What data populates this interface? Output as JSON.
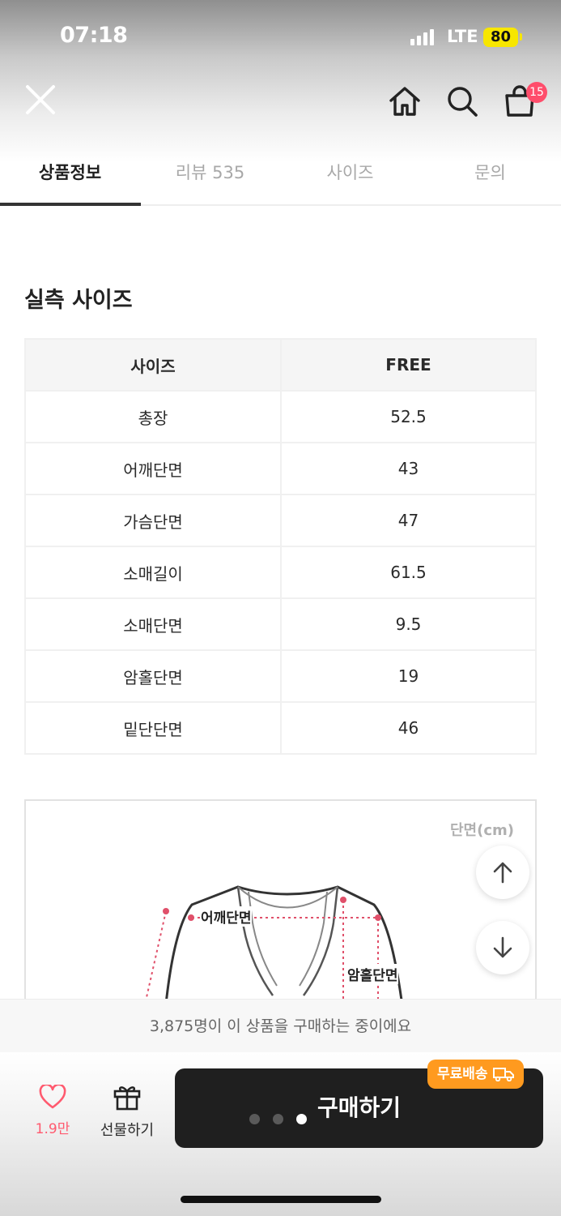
{
  "status_bar": {
    "time": "07:18",
    "network": "LTE",
    "battery": "80"
  },
  "nav": {
    "cart_count": "15"
  },
  "tabs": [
    {
      "label": "상품정보",
      "active": true
    },
    {
      "label": "리뷰 535",
      "active": false
    },
    {
      "label": "사이즈",
      "active": false
    },
    {
      "label": "문의",
      "active": false
    }
  ],
  "size_section": {
    "title": "실측 사이즈",
    "header": [
      "사이즈",
      "FREE"
    ],
    "rows": [
      [
        "총장",
        "52.5"
      ],
      [
        "어깨단면",
        "43"
      ],
      [
        "가슴단면",
        "47"
      ],
      [
        "소매길이",
        "61.5"
      ],
      [
        "소매단면",
        "9.5"
      ],
      [
        "암홀단면",
        "19"
      ],
      [
        "밑단단면",
        "46"
      ]
    ]
  },
  "diagram": {
    "unit": "단면(cm)",
    "label_shoulder": "어깨단면",
    "label_armhole": "암홀단면"
  },
  "purchase_notice": "3,875명이 이 상품을 구매하는 중이에요",
  "bottom_bar": {
    "wish_count": "1.9만",
    "gift_label": "선물하기",
    "buy_label": "구매하기",
    "free_shipping_badge": "무료배송"
  },
  "icons": [
    "close-icon",
    "home-icon",
    "search-icon",
    "cart-icon",
    "arrow-up-icon",
    "arrow-down-icon",
    "heart-icon",
    "gift-icon",
    "truck-icon"
  ],
  "colors": {
    "accent_pink": "#ff5a6f",
    "badge_orange": "#ff9a1f",
    "buy_button": "#1f1f1f"
  }
}
